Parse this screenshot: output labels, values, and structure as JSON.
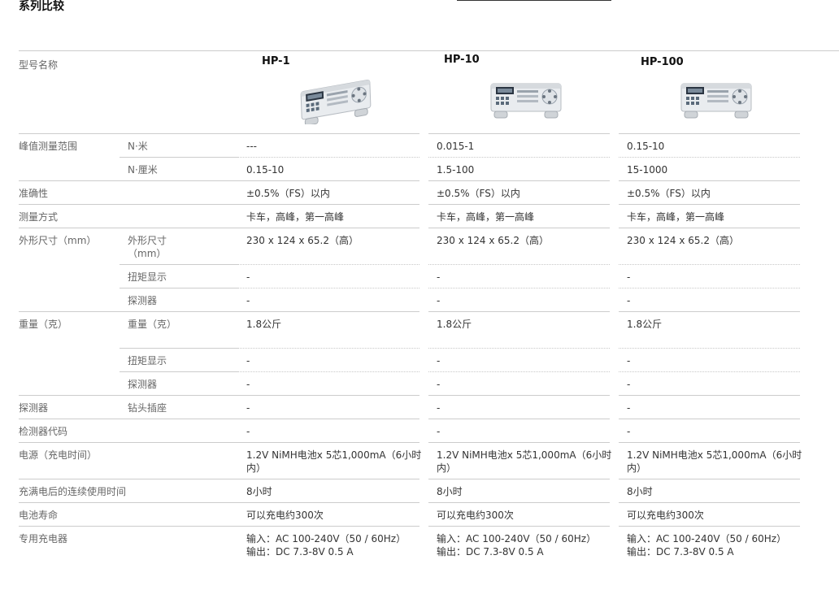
{
  "page": {
    "title": "系列比较"
  },
  "header_label": "型号名称",
  "models": [
    {
      "name": "HP-1",
      "image": "device-photo-hp-1"
    },
    {
      "name": "HP-10",
      "image": "device-photo-hp-10"
    },
    {
      "name": "HP-100",
      "image": "device-photo-hp-100"
    }
  ],
  "rows": [
    {
      "label": "峰值测量范围",
      "sub": "N·米",
      "values": [
        "---",
        "0.015-1",
        "0.15-10"
      ]
    },
    {
      "label": "",
      "sub": "N·厘米",
      "values": [
        "0.15-10",
        "1.5-100",
        "15-1000"
      ]
    },
    {
      "label": "准确性",
      "sub": "",
      "values": [
        "±0.5%（FS）以内",
        "±0.5%（FS）以内",
        "±0.5%（FS）以内"
      ]
    },
    {
      "label": "测量方式",
      "sub": "",
      "values": [
        "卡车，高峰，第一高峰",
        "卡车，高峰，第一高峰",
        "卡车，高峰，第一高峰"
      ]
    },
    {
      "label": "外形尺寸（mm）",
      "sub": "外形尺寸（mm）",
      "values": [
        "230 x 124 x 65.2（高）",
        "230 x 124 x 65.2（高）",
        "230 x 124 x 65.2（高）"
      ]
    },
    {
      "label": "",
      "sub": "扭矩显示",
      "values": [
        "-",
        "-",
        "-"
      ]
    },
    {
      "label": "",
      "sub": "探测器",
      "values": [
        "-",
        "-",
        "-"
      ]
    },
    {
      "label": "重量（克）",
      "sub": "重量（克）",
      "values": [
        "1.8公斤",
        "1.8公斤",
        "1.8公斤"
      ]
    },
    {
      "label": "",
      "sub": "扭矩显示",
      "values": [
        "-",
        "-",
        "-"
      ]
    },
    {
      "label": "",
      "sub": "探测器",
      "values": [
        "-",
        "-",
        "-"
      ]
    },
    {
      "label": "探测器",
      "sub": "钻头插座",
      "values": [
        "-",
        "-",
        "-"
      ]
    },
    {
      "label": "检测器代码",
      "sub": "",
      "values": [
        "-",
        "-",
        "-"
      ]
    },
    {
      "label": "电源（充电时间）",
      "sub": "",
      "values": [
        "1.2V NiMH电池x 5芯1,000mA（6小时内）",
        "1.2V NiMH电池x 5芯1,000mA（6小时内）",
        "1.2V NiMH电池x 5芯1,000mA（6小时内）"
      ]
    },
    {
      "label": "充满电后的连续使用时间",
      "sub": "",
      "values": [
        "8小时",
        "8小时",
        "8小时"
      ]
    },
    {
      "label": "电池寿命",
      "sub": "",
      "values": [
        "可以充电约300次",
        "可以充电约300次",
        "可以充电约300次"
      ]
    },
    {
      "label": "专用充电器",
      "sub": "",
      "values": [
        "输入：AC 100-240V（50 / 60Hz）\n输出：DC 7.3-8V 0.5 A",
        "输入：AC 100-240V（50 / 60Hz）\n输出：DC 7.3-8V 0.5 A",
        "输入：AC 100-240V（50 / 60Hz）\n输出：DC 7.3-8V 0.5 A"
      ]
    }
  ]
}
